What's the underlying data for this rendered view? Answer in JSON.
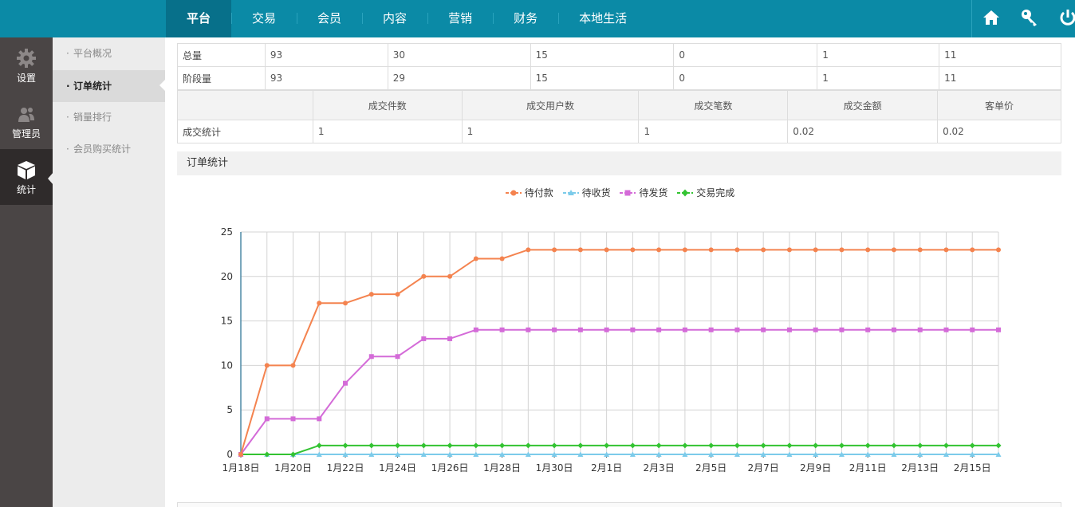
{
  "topnav": {
    "items": [
      {
        "label": "平台",
        "active": true
      },
      {
        "label": "交易",
        "active": false
      },
      {
        "label": "会员",
        "active": false
      },
      {
        "label": "内容",
        "active": false
      },
      {
        "label": "营销",
        "active": false
      },
      {
        "label": "财务",
        "active": false
      },
      {
        "label": "本地生活",
        "active": false
      }
    ],
    "icons": [
      "home-icon",
      "key-icon",
      "power-icon"
    ]
  },
  "sidebar": {
    "items": [
      {
        "label": "设置",
        "icon": "gear-icon"
      },
      {
        "label": "管理员",
        "icon": "users-icon"
      },
      {
        "label": "统计",
        "icon": "cube-icon",
        "active": true
      }
    ]
  },
  "subnav": {
    "items": [
      {
        "label": "平台概况"
      },
      {
        "label": "订单统计",
        "active": true
      },
      {
        "label": "销量排行"
      },
      {
        "label": "会员购买统计"
      }
    ]
  },
  "summary_table": {
    "rows": [
      {
        "label": "总量",
        "values": [
          "93",
          "30",
          "15",
          "0",
          "1",
          "11"
        ]
      },
      {
        "label": "阶段量",
        "values": [
          "93",
          "29",
          "15",
          "0",
          "1",
          "11"
        ]
      }
    ]
  },
  "deal_table": {
    "headers": [
      "",
      "成交件数",
      "成交用户数",
      "成交笔数",
      "成交金额",
      "客单价"
    ],
    "row": {
      "label": "成交统计",
      "values": [
        "1",
        "1",
        "1",
        "0.02",
        "0.02"
      ]
    }
  },
  "section": {
    "title": "订单统计"
  },
  "colors": {
    "primary": "#0b8aa6",
    "series_pending_pay": "#f4834f",
    "series_pending_receive": "#7ccbea",
    "series_pending_ship": "#d46bd8",
    "series_completed": "#33c332"
  },
  "chart_data": {
    "type": "line",
    "title": "",
    "xlabel": "",
    "ylabel": "",
    "ylim": [
      0,
      25
    ],
    "yticks": [
      0,
      5,
      10,
      15,
      20,
      25
    ],
    "grid": true,
    "legend_position": "top-center",
    "x": [
      "1月18日",
      "1月19日",
      "1月20日",
      "1月21日",
      "1月22日",
      "1月23日",
      "1月24日",
      "1月25日",
      "1月26日",
      "1月27日",
      "1月28日",
      "1月29日",
      "1月30日",
      "1月31日",
      "2月1日",
      "2月2日",
      "2月3日",
      "2月4日",
      "2月5日",
      "2月6日",
      "2月7日",
      "2月8日",
      "2月9日",
      "2月10日",
      "2月11日",
      "2月12日",
      "2月13日",
      "2月14日",
      "2月15日",
      "2月16日"
    ],
    "x_tick_labels": [
      "1月18日",
      "1月20日",
      "1月22日",
      "1月24日",
      "1月26日",
      "1月28日",
      "1月30日",
      "2月1日",
      "2月3日",
      "2月5日",
      "2月7日",
      "2月9日",
      "2月11日",
      "2月13日",
      "2月15日"
    ],
    "series": [
      {
        "name": "待付款",
        "marker": "circle",
        "values": [
          0,
          10,
          10,
          17,
          17,
          18,
          18,
          20,
          20,
          22,
          22,
          23,
          23,
          23,
          23,
          23,
          23,
          23,
          23,
          23,
          23,
          23,
          23,
          23,
          23,
          23,
          23,
          23,
          23,
          23
        ]
      },
      {
        "name": "待收货",
        "marker": "triangle",
        "values": [
          0,
          0,
          0,
          0,
          0,
          0,
          0,
          0,
          0,
          0,
          0,
          0,
          0,
          0,
          0,
          0,
          0,
          0,
          0,
          0,
          0,
          0,
          0,
          0,
          0,
          0,
          0,
          0,
          0,
          0
        ]
      },
      {
        "name": "待发货",
        "marker": "square",
        "values": [
          0,
          4,
          4,
          4,
          8,
          11,
          11,
          13,
          13,
          14,
          14,
          14,
          14,
          14,
          14,
          14,
          14,
          14,
          14,
          14,
          14,
          14,
          14,
          14,
          14,
          14,
          14,
          14,
          14,
          14
        ]
      },
      {
        "name": "交易完成",
        "marker": "diamond",
        "values": [
          0,
          0,
          0,
          1,
          1,
          1,
          1,
          1,
          1,
          1,
          1,
          1,
          1,
          1,
          1,
          1,
          1,
          1,
          1,
          1,
          1,
          1,
          1,
          1,
          1,
          1,
          1,
          1,
          1,
          1
        ]
      }
    ]
  }
}
